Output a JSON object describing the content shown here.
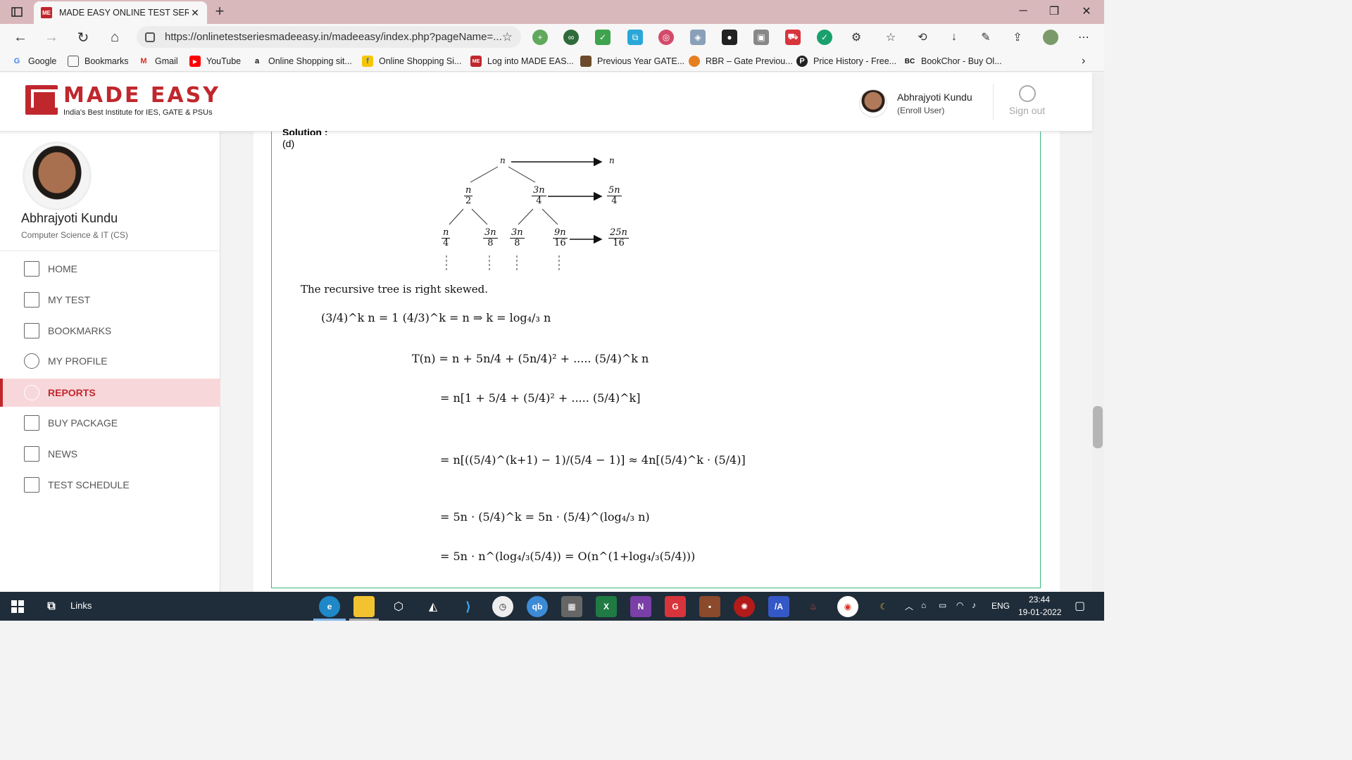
{
  "browser": {
    "tab_title": "MADE EASY ONLINE TEST SERIES",
    "url": "https://onlinetestseriesmadeeasy.in/madeeasy/index.php?pageName=...",
    "bookmarks": [
      {
        "label": "Google",
        "icon": "google-icon",
        "color": "#4285f4"
      },
      {
        "label": "Bookmarks",
        "icon": "page-icon",
        "color": "#555555"
      },
      {
        "label": "Gmail",
        "icon": "gmail-icon",
        "color": "#d93025"
      },
      {
        "label": "YouTube",
        "icon": "youtube-icon",
        "color": "#ff0000"
      },
      {
        "label": "Online Shopping sit...",
        "icon": "amazon-icon",
        "color": "#111111"
      },
      {
        "label": "Online Shopping Si...",
        "icon": "flipkart-icon",
        "color": "#f7c600"
      },
      {
        "label": "Log into MADE EAS...",
        "icon": "madeeasy-icon",
        "color": "#c0272d"
      },
      {
        "label": "Previous Year GATE...",
        "icon": "gate-icon",
        "color": "#6b4b2b"
      },
      {
        "label": "RBR – Gate Previou...",
        "icon": "rbr-icon",
        "color": "#e67e22"
      },
      {
        "label": "Price History - Free...",
        "icon": "price-history-icon",
        "color": "#222222"
      },
      {
        "label": "BookChor - Buy Ol...",
        "icon": "bookchor-icon",
        "color": "#111111"
      }
    ]
  },
  "header": {
    "logo_text": "MADE EASY",
    "tagline": "India's Best Institute for IES, GATE & PSUs",
    "user_name": "Abhrajyoti Kundu",
    "user_role": "(Enroll User)",
    "signout_label": "Sign out"
  },
  "sidebar": {
    "name": "Abhrajyoti Kundu",
    "branch": "Computer Science & IT (CS)",
    "items": [
      {
        "label": "HOME",
        "icon": "home-icon",
        "active": false
      },
      {
        "label": "MY TEST",
        "icon": "test-icon",
        "active": false
      },
      {
        "label": "BOOKMARKS",
        "icon": "bookmark-icon",
        "active": false
      },
      {
        "label": "MY PROFILE",
        "icon": "profile-icon",
        "active": false
      },
      {
        "label": "REPORTS",
        "icon": "reports-icon",
        "active": true
      },
      {
        "label": "BUY PACKAGE",
        "icon": "cart-icon",
        "active": false
      },
      {
        "label": "NEWS",
        "icon": "news-icon",
        "active": false
      },
      {
        "label": "TEST SCHEDULE",
        "icon": "schedule-icon",
        "active": false
      }
    ]
  },
  "solution": {
    "label": "Solution :",
    "answer": "(d)",
    "tree_nodes": {
      "root": "n",
      "root_sum": "n",
      "l1_left": [
        "n",
        "2"
      ],
      "l1_right": [
        "3n",
        "4"
      ],
      "l1_sum": [
        "5n",
        "4"
      ],
      "l2": [
        [
          "n",
          "4"
        ],
        [
          "3n",
          "8"
        ],
        [
          "3n",
          "8"
        ],
        [
          "9n",
          "16"
        ]
      ],
      "l2_sum": [
        "25n",
        "16"
      ]
    },
    "description": "The recursive tree is right skewed.",
    "eq1": "(3/4)^k n = 1     (4/3)^k = n ⇒ k = log₄/₃ n",
    "eq2": "T(n)  =  n + 5n/4 + (5n/4)² + ..... (5/4)^k n",
    "eq3": "=  n[1 + 5/4 + (5/4)² + ..... (5/4)^k]",
    "eq4": "=  n[((5/4)^(k+1) − 1)/(5/4 − 1)]  ≈ 4n[(5/4)^k · (5/4)]",
    "eq5": "=  5n · (5/4)^k = 5n · (5/4)^(log₄/₃ n)",
    "eq6": "=  5n · n^(log₄/₃(5/4))  =  O(n^(1+log₄/₃(5/4)))"
  },
  "taskbar": {
    "links_label": "Links",
    "language": "ENG",
    "time": "23:44",
    "date": "19-01-2022"
  }
}
